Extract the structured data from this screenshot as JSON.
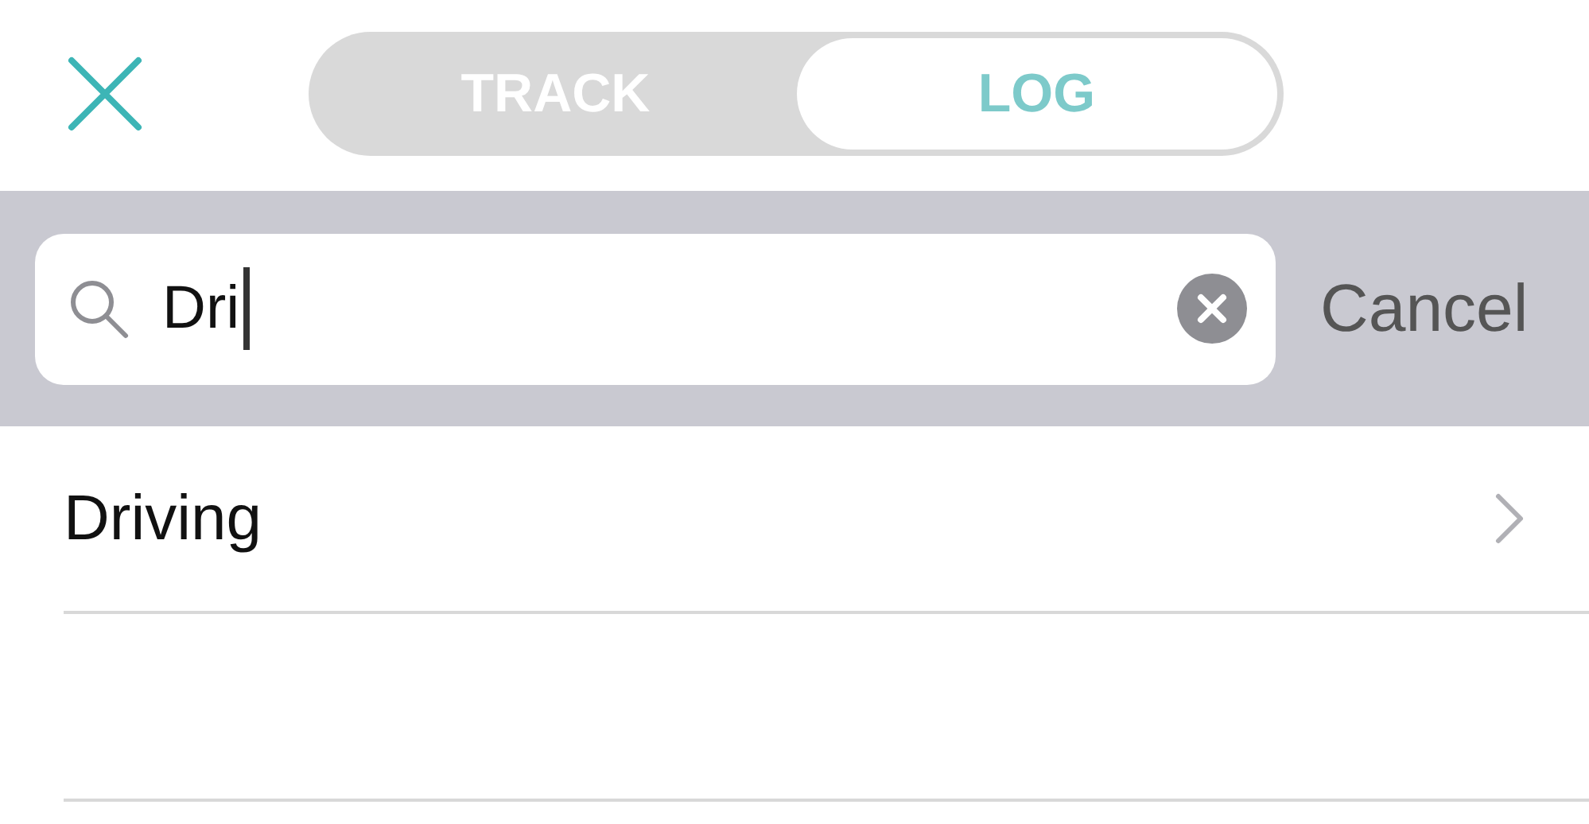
{
  "tabs": [
    {
      "label": "TRACK",
      "selected": false
    },
    {
      "label": "LOG",
      "selected": true
    }
  ],
  "search": {
    "value": "Dri",
    "cancel": "Cancel"
  },
  "results": [
    {
      "label": "Driving"
    }
  ]
}
